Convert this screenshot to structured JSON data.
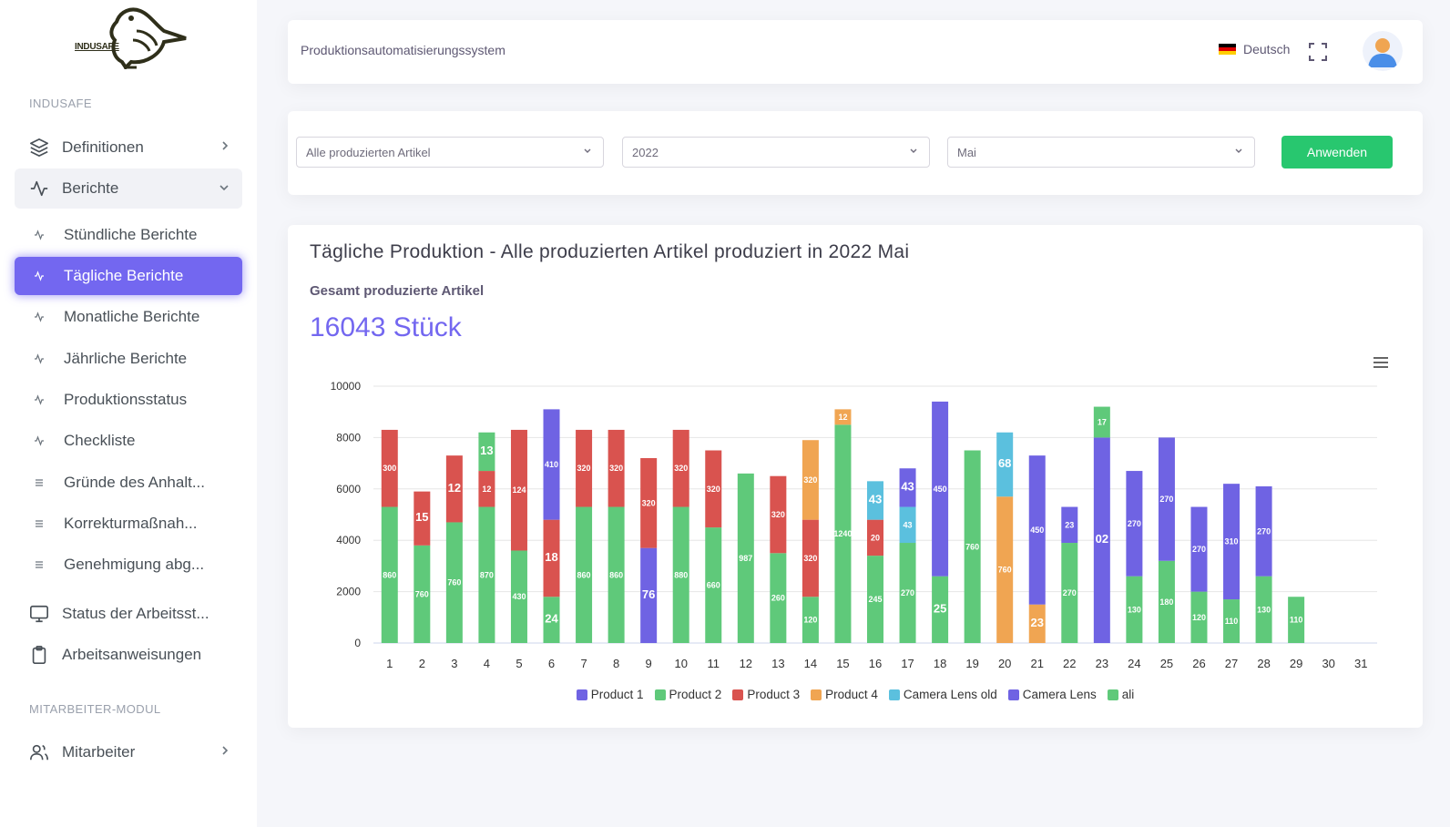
{
  "brand": {
    "logo_text": "INDUSAFE"
  },
  "sidebar": {
    "section1": "INDUSAFE",
    "definitionen": "Definitionen",
    "berichte": "Berichte",
    "sub_items": [
      {
        "label": "Stündliche Berichte",
        "icon": "activity-icon"
      },
      {
        "label": "Tägliche Berichte",
        "icon": "activity-icon"
      },
      {
        "label": "Monatliche Berichte",
        "icon": "activity-icon"
      },
      {
        "label": "Jährliche Berichte",
        "icon": "activity-icon"
      },
      {
        "label": "Produktionsstatus",
        "icon": "activity-icon"
      },
      {
        "label": "Checkliste",
        "icon": "activity-icon"
      },
      {
        "label": "Gründe des Anhalt...",
        "icon": "list-icon"
      },
      {
        "label": "Korrekturmaßnah...",
        "icon": "list-icon"
      },
      {
        "label": "Genehmigung abg...",
        "icon": "list-icon"
      }
    ],
    "status": "Status der Arbeitsst...",
    "anweisungen": "Arbeitsanweisungen",
    "section2": "MITARBEITER-MODUL",
    "mitarbeiter": "Mitarbeiter"
  },
  "header": {
    "title": "Produktionsautomatisierungssystem",
    "language": "Deutsch"
  },
  "filters": {
    "article": "Alle produzierten Artikel",
    "year": "2022",
    "month": "Mai",
    "apply": "Anwenden"
  },
  "report": {
    "title": "Tägliche Produktion - Alle produzierten Artikel produziert in 2022 Mai",
    "total_label": "Gesamt produzierte Artikel",
    "total_value": "16043 Stück"
  },
  "colors": {
    "Product 1": "#6f63e3",
    "Product 2": "#5fc97a",
    "Product 3": "#d9534f",
    "Product 4": "#f0a552",
    "Camera Lens old": "#5bc0de",
    "Camera Lens": "#6f63e3",
    "ali": "#5fc97a",
    "accent": "#7367f0",
    "apply": "#28c76f"
  },
  "chart_data": {
    "type": "bar",
    "stacked": true,
    "categories": [
      "1",
      "2",
      "3",
      "4",
      "5",
      "6",
      "7",
      "8",
      "9",
      "10",
      "11",
      "12",
      "13",
      "14",
      "15",
      "16",
      "17",
      "18",
      "19",
      "20",
      "21",
      "22",
      "23",
      "24",
      "25",
      "26",
      "27",
      "28",
      "29",
      "30",
      "31"
    ],
    "ylim": [
      0,
      10000
    ],
    "yticks": [
      0,
      2000,
      4000,
      6000,
      8000,
      10000
    ],
    "grid": true,
    "legend_position": "bottom",
    "series": [
      {
        "name": "Product 1",
        "values": [
          0,
          0,
          0,
          0,
          0,
          0,
          0,
          0,
          3700,
          0,
          0,
          0,
          0,
          0,
          0,
          0,
          0,
          0,
          0,
          0,
          0,
          0,
          0,
          0,
          0,
          0,
          0,
          0,
          0,
          0,
          0
        ],
        "labels": [
          "",
          "",
          "",
          "",
          "",
          "",
          "",
          "",
          "76",
          "",
          "",
          "",
          "",
          "",
          "",
          "",
          "",
          "",
          "",
          "",
          "",
          "",
          "",
          "",
          "",
          "",
          "",
          "",
          "",
          "",
          ""
        ]
      },
      {
        "name": "Product 2",
        "values": [
          5300,
          3800,
          4700,
          5300,
          3600,
          1800,
          5300,
          5300,
          0,
          5300,
          4500,
          6600,
          3500,
          1800,
          8500,
          3400,
          3900,
          2600,
          7500,
          0,
          0,
          3900,
          0,
          2600,
          3200,
          2000,
          1700,
          2600,
          1800,
          0,
          0
        ],
        "labels": [
          "860",
          "760",
          "760",
          "870",
          "430",
          "24",
          "860",
          "860",
          "",
          "880",
          "660",
          "987",
          "260",
          "120",
          "1240",
          "245",
          "270",
          "25",
          "760",
          "",
          "",
          "270",
          "",
          "130",
          "180",
          "120",
          "110",
          "130",
          "110",
          "",
          ""
        ]
      },
      {
        "name": "Product 3",
        "values": [
          3000,
          2100,
          2600,
          1400,
          4700,
          3000,
          3000,
          3000,
          3500,
          3000,
          3000,
          0,
          3000,
          3000,
          0,
          1400,
          0,
          0,
          0,
          0,
          0,
          0,
          0,
          0,
          0,
          0,
          0,
          0,
          0,
          0,
          0
        ],
        "labels": [
          "300",
          "15",
          "12",
          "12",
          "124",
          "18",
          "320",
          "320",
          "320",
          "320",
          "320",
          "",
          "320",
          "320",
          "",
          "20",
          "",
          "",
          "",
          "",
          "",
          "",
          "",
          "",
          "",
          "",
          "",
          "",
          "",
          "",
          ""
        ]
      },
      {
        "name": "Product 4",
        "values": [
          0,
          0,
          0,
          0,
          0,
          0,
          0,
          0,
          0,
          0,
          0,
          0,
          0,
          3100,
          600,
          0,
          0,
          0,
          0,
          5700,
          1500,
          0,
          0,
          0,
          0,
          0,
          0,
          0,
          0,
          0,
          0
        ],
        "labels": [
          "",
          "",
          "",
          "",
          "",
          "",
          "",
          "",
          "",
          "",
          "",
          "",
          "",
          "320",
          "12",
          "",
          "",
          "",
          "",
          "760",
          "23",
          "",
          "",
          "",
          "",
          "",
          "",
          "",
          "",
          "",
          ""
        ]
      },
      {
        "name": "Camera Lens old",
        "values": [
          0,
          0,
          0,
          0,
          0,
          0,
          0,
          0,
          0,
          0,
          0,
          0,
          0,
          0,
          0,
          1500,
          1400,
          0,
          0,
          2500,
          0,
          0,
          0,
          0,
          0,
          0,
          0,
          0,
          0,
          0,
          0
        ],
        "labels": [
          "",
          "",
          "",
          "",
          "",
          "",
          "",
          "",
          "",
          "",
          "",
          "",
          "",
          "",
          "",
          "43",
          "43",
          "",
          "",
          "68",
          "",
          "",
          "",
          "",
          "",
          "",
          "",
          "",
          "",
          "",
          ""
        ]
      },
      {
        "name": "Camera Lens",
        "values": [
          0,
          0,
          0,
          0,
          0,
          4300,
          0,
          0,
          0,
          0,
          0,
          0,
          0,
          0,
          0,
          0,
          1500,
          6800,
          0,
          0,
          5800,
          1400,
          8000,
          4100,
          4800,
          3300,
          4500,
          3500,
          0,
          0,
          0
        ],
        "labels": [
          "",
          "",
          "",
          "",
          "",
          "410",
          "",
          "",
          "",
          "",
          "",
          "",
          "",
          "",
          "",
          "",
          "43",
          "450",
          "",
          "",
          "450",
          "23",
          "02",
          "270",
          "270",
          "270",
          "310",
          "270",
          "",
          "",
          ""
        ]
      },
      {
        "name": "ali",
        "values": [
          0,
          0,
          0,
          1500,
          0,
          0,
          0,
          0,
          0,
          0,
          0,
          0,
          0,
          0,
          0,
          0,
          0,
          0,
          0,
          0,
          0,
          0,
          1200,
          0,
          0,
          0,
          0,
          0,
          0,
          0,
          0
        ],
        "labels": [
          "",
          "",
          "",
          "13",
          "",
          "",
          "",
          "",
          "",
          "",
          "",
          "",
          "",
          "",
          "",
          "",
          "",
          "",
          "",
          "",
          "",
          "",
          "17",
          "",
          "",
          "",
          "",
          "",
          "",
          "",
          ""
        ]
      }
    ]
  }
}
